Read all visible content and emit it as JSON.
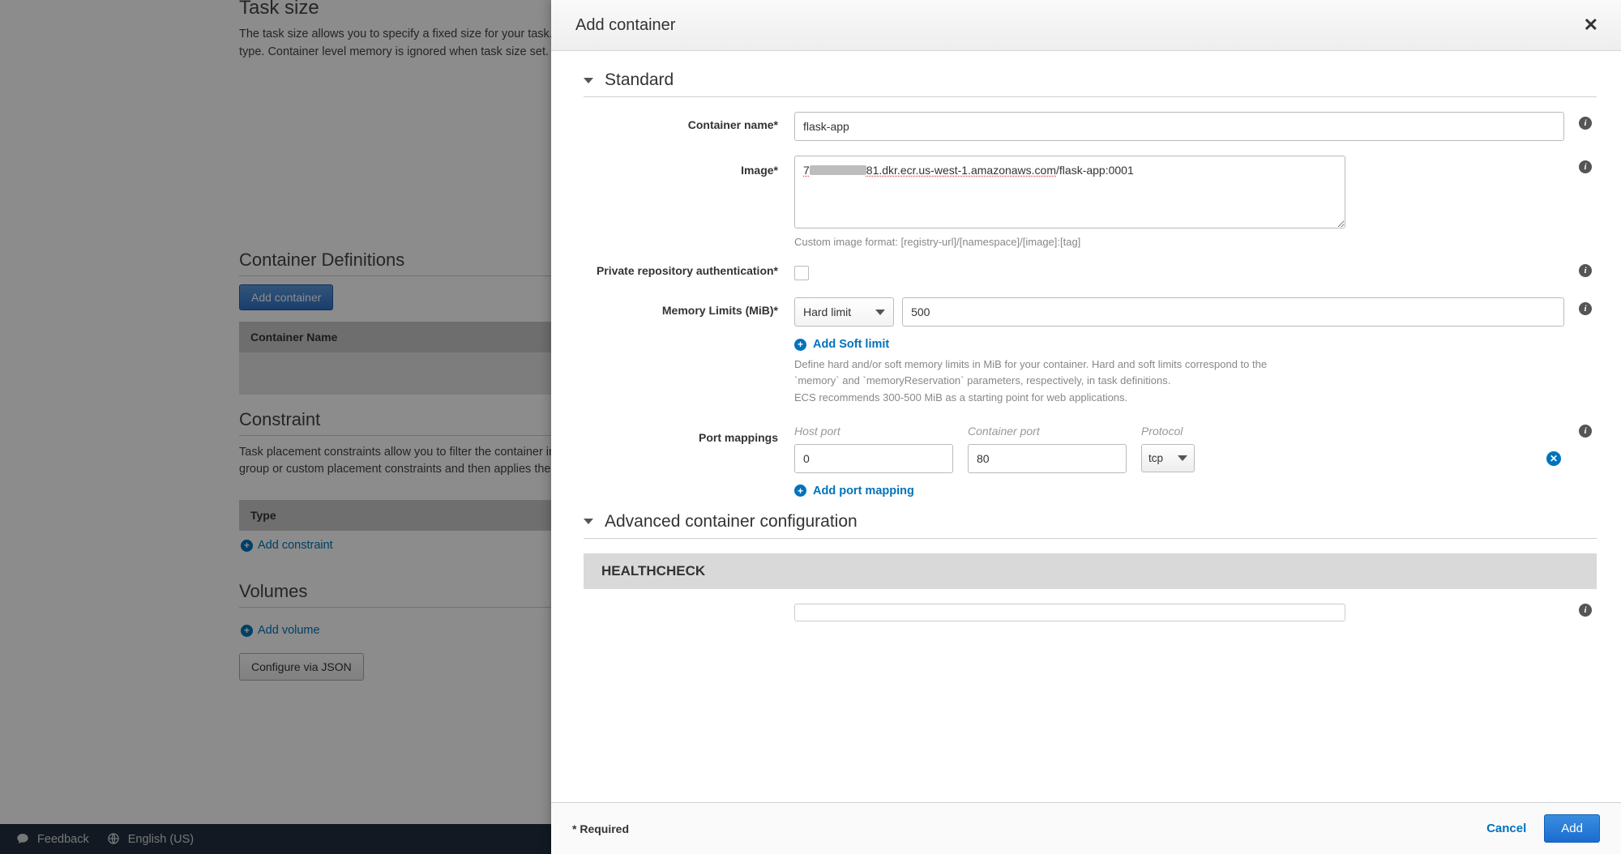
{
  "bg": {
    "task_size_title": "Task size",
    "task_size_desc": "The task size allows you to specify a fixed size for your task. Task size is required for tasks using the Fargate launch type but is optional for EC2 launch type. Container level memory is ignored when task size set. Task size is not supported for Windows containers.",
    "container_defs_title": "Container Definitions",
    "add_container_btn": "Add container",
    "container_name_col": "Container Name",
    "constraint_title": "Constraint",
    "constraint_desc": "Task placement constraints allow you to filter the container instances that tasks are placed on. ECS first filters on cluster constraints, then filters on task group or custom placement constraints and then applies the placement strategy.",
    "type_col": "Type",
    "add_constraint": "Add constraint",
    "volumes_title": "Volumes",
    "add_volume": "Add volume",
    "configure_json": "Configure via JSON"
  },
  "footer": {
    "feedback": "Feedback",
    "language": "English (US)"
  },
  "modal": {
    "title": "Add container",
    "section_standard": "Standard",
    "container_name_label": "Container name*",
    "container_name_value": "flask-app",
    "image_label": "Image*",
    "image_prefix": "7",
    "image_suffix": "81.dkr.ecr.us-west-1.amazonaws.com",
    "image_tag": "/flask-app:0001",
    "image_hint": "Custom image format: [registry-url]/[namespace]/[image]:[tag]",
    "private_repo_label": "Private repository authentication*",
    "mem_label": "Memory Limits (MiB)*",
    "mem_type": "Hard limit",
    "mem_value": "500",
    "add_soft": "Add Soft limit",
    "mem_hint1": "Define hard and/or soft memory limits in MiB for your container. Hard and soft limits correspond to the",
    "mem_hint2": "`memory` and `memoryReservation` parameters, respectively, in task definitions.",
    "mem_hint3": "ECS recommends 300-500 MiB as a starting point for web applications.",
    "port_label": "Port mappings",
    "port_h1": "Host port",
    "port_h2": "Container port",
    "port_h3": "Protocol",
    "host_port": "0",
    "container_port": "80",
    "protocol": "tcp",
    "add_port": "Add port mapping",
    "section_advanced": "Advanced container configuration",
    "healthcheck": "HEALTHCHECK",
    "required": "* Required",
    "cancel": "Cancel",
    "add": "Add"
  }
}
